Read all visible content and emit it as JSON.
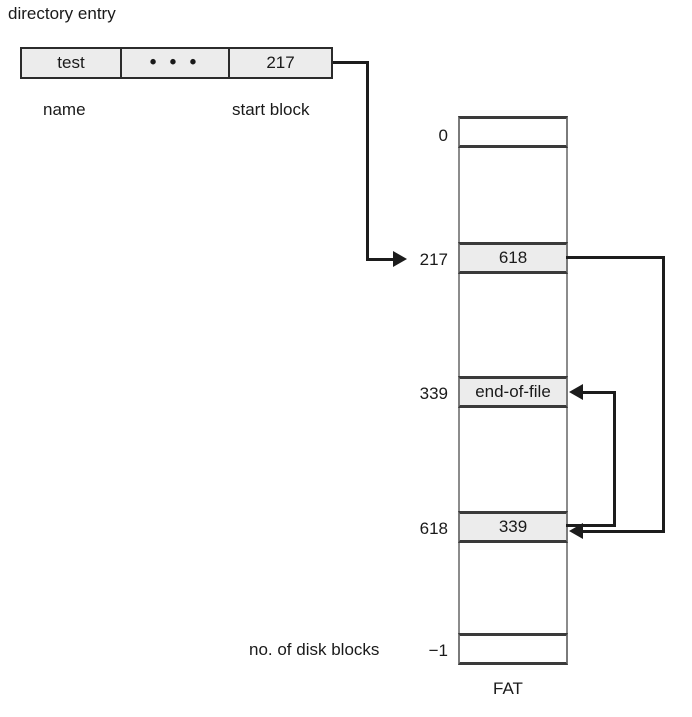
{
  "diagram": {
    "title_label": "directory entry",
    "fat_caption": "FAT",
    "disk_blocks_label": "no. of disk blocks"
  },
  "directory_entry": {
    "name_value": "test",
    "middle_value": "• • •",
    "start_block_value": "217",
    "name_caption": "name",
    "start_block_caption": "start block"
  },
  "fat": {
    "rows": [
      {
        "index": "0",
        "value": "",
        "filled": false
      },
      {
        "index": "217",
        "value": "618",
        "filled": true
      },
      {
        "index": "339",
        "value": "end-of-file",
        "filled": true
      },
      {
        "index": "618",
        "value": "339",
        "filled": true
      },
      {
        "index": "−1",
        "value": "",
        "filled": false
      }
    ]
  },
  "colors": {
    "cell_fill": "#ececec",
    "line": "#1c1c1c",
    "border": "#3a3a3a",
    "background": "#ffffff"
  }
}
